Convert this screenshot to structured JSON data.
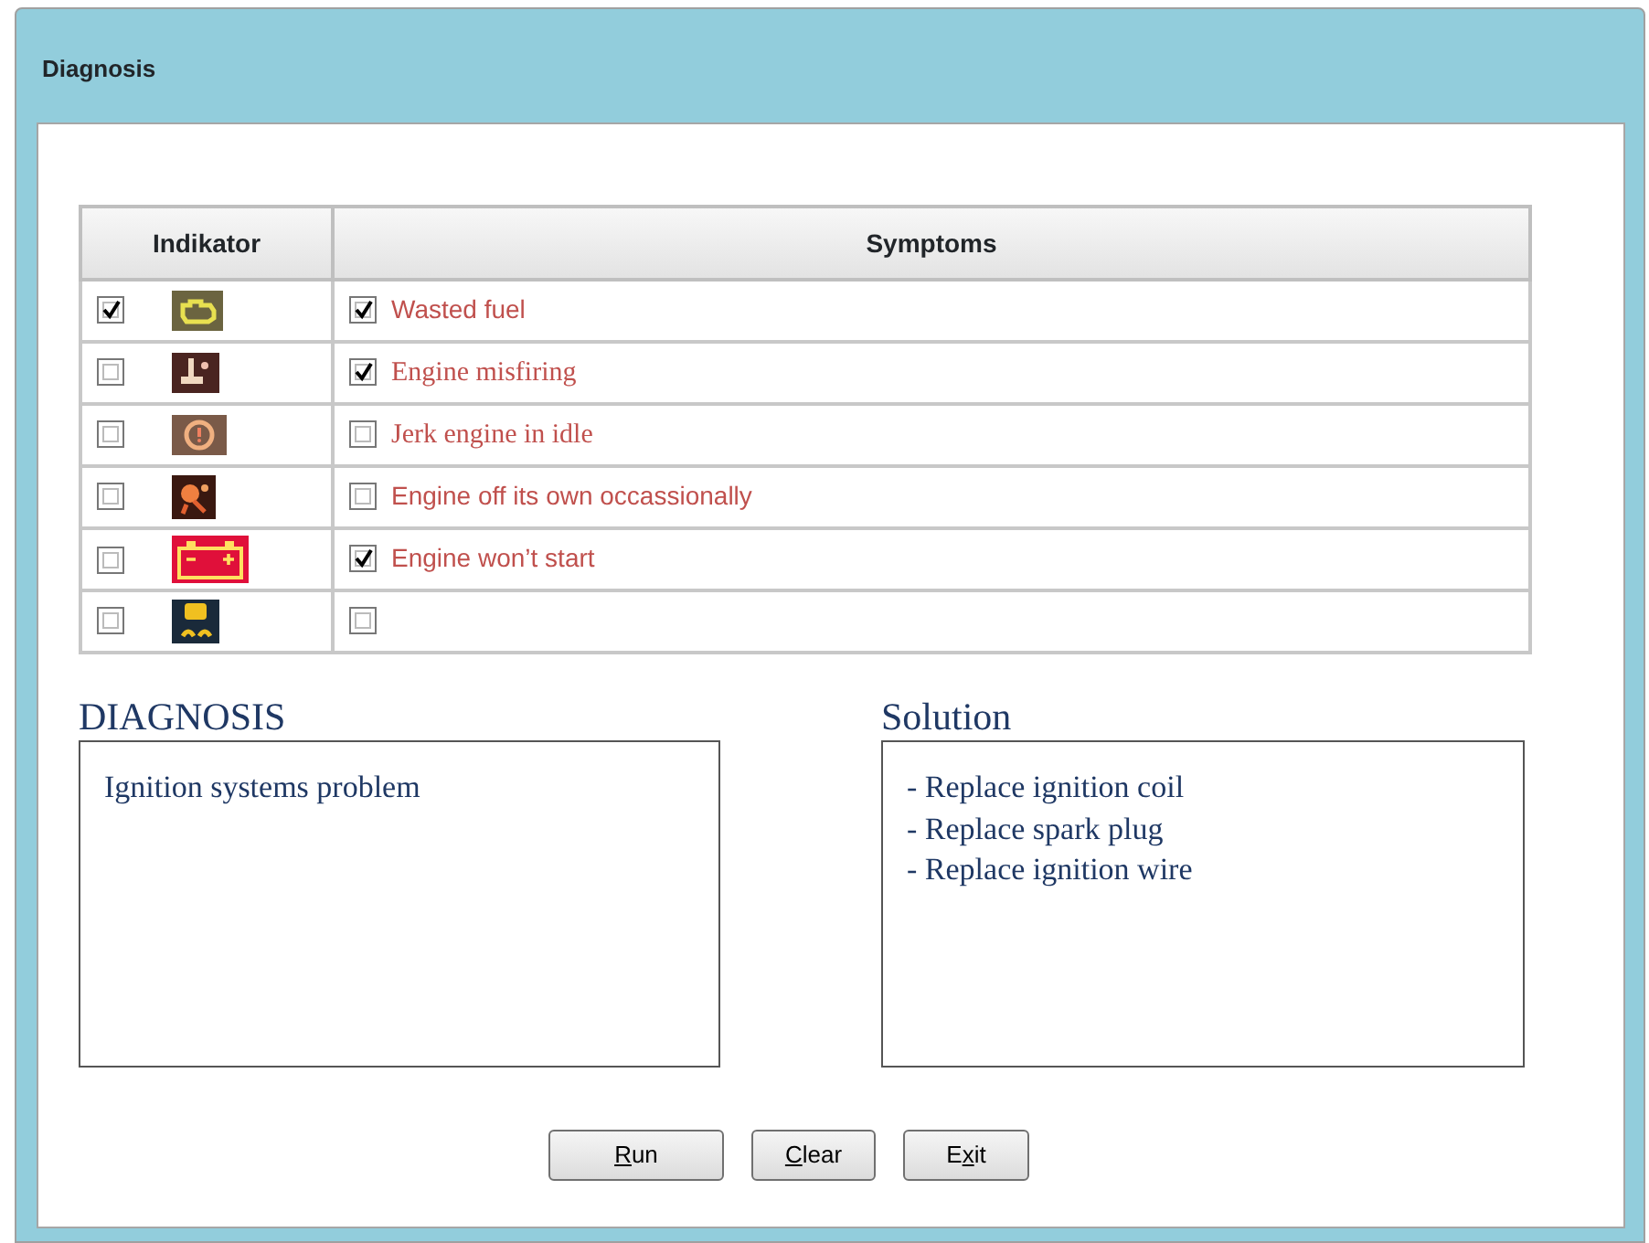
{
  "window": {
    "title": "Diagnosis"
  },
  "table": {
    "columns": [
      "Indikator",
      "Symptoms"
    ],
    "rows": [
      {
        "indicator_checked": true,
        "kind": "engine",
        "symptom_checked": true,
        "symptom": "Wasted fuel",
        "serif": false
      },
      {
        "indicator_checked": false,
        "kind": "temperature",
        "symptom_checked": true,
        "symptom": "Engine misfiring",
        "serif": true
      },
      {
        "indicator_checked": false,
        "kind": "brake",
        "symptom_checked": false,
        "symptom": "Jerk engine in idle",
        "serif": true
      },
      {
        "indicator_checked": false,
        "kind": "airbag",
        "symptom_checked": false,
        "symptom": "Engine off its own occassionally",
        "serif": false
      },
      {
        "indicator_checked": false,
        "kind": "battery",
        "symptom_checked": true,
        "symptom": "Engine won’t start",
        "serif": false
      },
      {
        "indicator_checked": false,
        "kind": "traction",
        "symptom_checked": false
      }
    ]
  },
  "diagnosis": {
    "label": "DIAGNOSIS",
    "lines": [
      "Ignition systems problem"
    ]
  },
  "solution": {
    "label": "Solution",
    "lines": [
      "- Replace ignition coil",
      "- Replace spark plug",
      "- Replace ignition wire"
    ]
  },
  "buttons": [
    {
      "key": "R",
      "after": "un"
    },
    {
      "key": "C",
      "after": "lear"
    },
    {
      "before": "E",
      "key": "x",
      "after": "it"
    }
  ]
}
